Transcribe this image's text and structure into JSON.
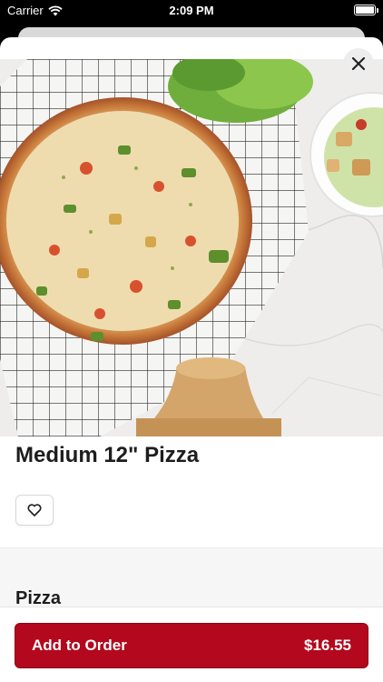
{
  "status_bar": {
    "carrier": "Carrier",
    "time": "2:09 PM",
    "wifi_icon": "wifi-icon",
    "battery_icon": "battery-icon"
  },
  "item": {
    "title": "Medium 12\" Pizza",
    "favorite_icon": "heart-icon",
    "close_icon": "close-icon"
  },
  "section": {
    "title": "Pizza"
  },
  "order_button": {
    "label": "Add to Order",
    "price": "$16.55"
  },
  "colors": {
    "accent": "#b3081d",
    "background": "#ffffff",
    "section_bg": "#f6f6f6"
  }
}
